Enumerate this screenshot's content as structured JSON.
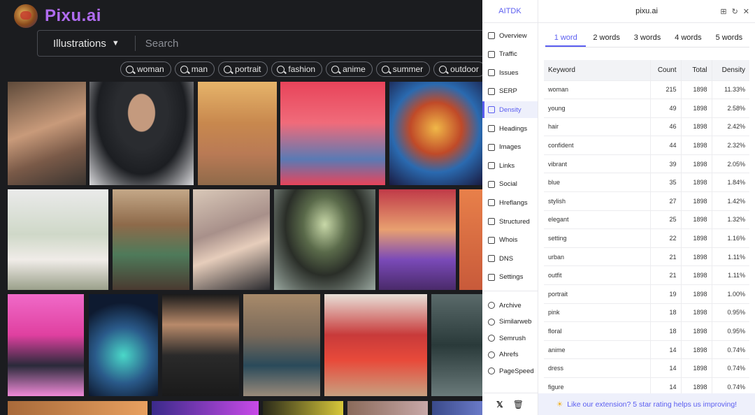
{
  "site": {
    "logo_text": "Pixu.ai",
    "category": "Illustrations",
    "search_placeholder": "Search",
    "tags": [
      "woman",
      "man",
      "portrait",
      "fashion",
      "anime",
      "summer",
      "outdoor"
    ]
  },
  "extension": {
    "brand": "AITDK",
    "domain": "pixu.ai",
    "nav": [
      {
        "label": "Overview",
        "icon": "list-icon"
      },
      {
        "label": "Traffic",
        "icon": "chart-icon"
      },
      {
        "label": "Issues",
        "icon": "warning-icon"
      },
      {
        "label": "SERP",
        "icon": "serp-icon"
      },
      {
        "label": "Density",
        "icon": "density-icon",
        "active": true
      },
      {
        "label": "Headings",
        "icon": "heading-icon"
      },
      {
        "label": "Images",
        "icon": "image-icon"
      },
      {
        "label": "Links",
        "icon": "link-icon"
      },
      {
        "label": "Social",
        "icon": "social-icon"
      },
      {
        "label": "Hreflangs",
        "icon": "globe-icon"
      },
      {
        "label": "Structured",
        "icon": "braces-icon"
      },
      {
        "label": "Whois",
        "icon": "person-icon"
      },
      {
        "label": "DNS",
        "icon": "server-icon"
      },
      {
        "label": "Settings",
        "icon": "gear-icon"
      }
    ],
    "tools": [
      {
        "label": "Archive",
        "icon": "archive-icon"
      },
      {
        "label": "Similarweb",
        "icon": "similarweb-icon"
      },
      {
        "label": "Semrush",
        "icon": "semrush-icon"
      },
      {
        "label": "Ahrefs",
        "icon": "ahrefs-icon"
      },
      {
        "label": "PageSpeed",
        "icon": "pagespeed-icon"
      }
    ],
    "tabs": [
      "1 word",
      "2 words",
      "3 words",
      "4 words",
      "5 words"
    ],
    "active_tab": 0,
    "table": {
      "headers": [
        "Keyword",
        "Count",
        "Total",
        "Density"
      ],
      "rows": [
        [
          "woman",
          "215",
          "1898",
          "11.33%"
        ],
        [
          "young",
          "49",
          "1898",
          "2.58%"
        ],
        [
          "hair",
          "46",
          "1898",
          "2.42%"
        ],
        [
          "confident",
          "44",
          "1898",
          "2.32%"
        ],
        [
          "vibrant",
          "39",
          "1898",
          "2.05%"
        ],
        [
          "blue",
          "35",
          "1898",
          "1.84%"
        ],
        [
          "stylish",
          "27",
          "1898",
          "1.42%"
        ],
        [
          "elegant",
          "25",
          "1898",
          "1.32%"
        ],
        [
          "setting",
          "22",
          "1898",
          "1.16%"
        ],
        [
          "urban",
          "21",
          "1898",
          "1.11%"
        ],
        [
          "outfit",
          "21",
          "1898",
          "1.11%"
        ],
        [
          "portrait",
          "19",
          "1898",
          "1.00%"
        ],
        [
          "pink",
          "18",
          "1898",
          "0.95%"
        ],
        [
          "floral",
          "18",
          "1898",
          "0.95%"
        ],
        [
          "anime",
          "14",
          "1898",
          "0.74%"
        ],
        [
          "dress",
          "14",
          "1898",
          "0.74%"
        ],
        [
          "figure",
          "14",
          "1898",
          "0.74%"
        ]
      ]
    },
    "footer_text": "Like our extension? 5 star rating helps us improving!",
    "colors": {
      "accent": "#5b5ef0",
      "logo": "#b06cf0"
    }
  }
}
